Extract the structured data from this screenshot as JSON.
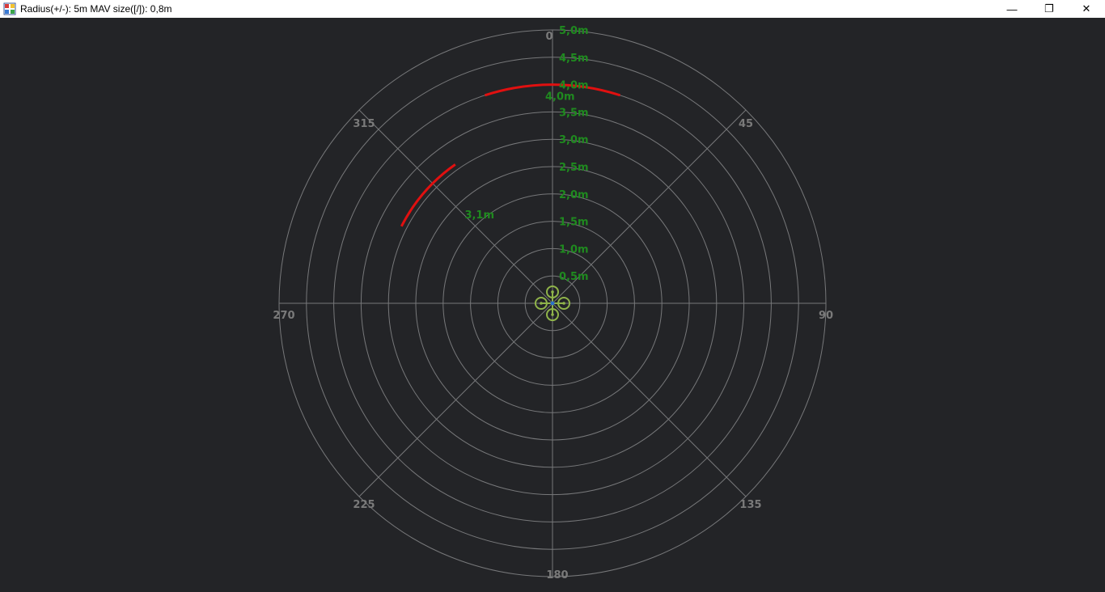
{
  "window": {
    "title": "Radius(+/-): 5m MAV size([/]): 0,8m",
    "minimize_glyph": "—",
    "restore_glyph": "❐",
    "close_glyph": "✕"
  },
  "radar": {
    "radius_m": 5.0,
    "ring_step_m": 0.5,
    "range_labels": [
      "0,5m",
      "1,0m",
      "1,5m",
      "2,0m",
      "2,5m",
      "3,0m",
      "3,5m",
      "4,0m",
      "4,5m",
      "5,0m"
    ],
    "bearing_labels": [
      "0",
      "45",
      "90",
      "135",
      "180",
      "225",
      "270",
      "315"
    ],
    "colors": {
      "background": "#232427",
      "grid": "#77787a",
      "bearing_label": "#7a7a7a",
      "range_label": "#1f8a1f",
      "obstacle": "#e01010",
      "mav": "#8fb34a"
    },
    "obstacles": [
      {
        "distance_m": 4.0,
        "distance_label": "4,0m",
        "start_deg": -18,
        "end_deg": 18
      },
      {
        "distance_m": 3.1,
        "distance_label": "3,1m",
        "start_deg": -63,
        "end_deg": -35
      }
    ],
    "mav": {
      "size_m": 0.8
    }
  }
}
